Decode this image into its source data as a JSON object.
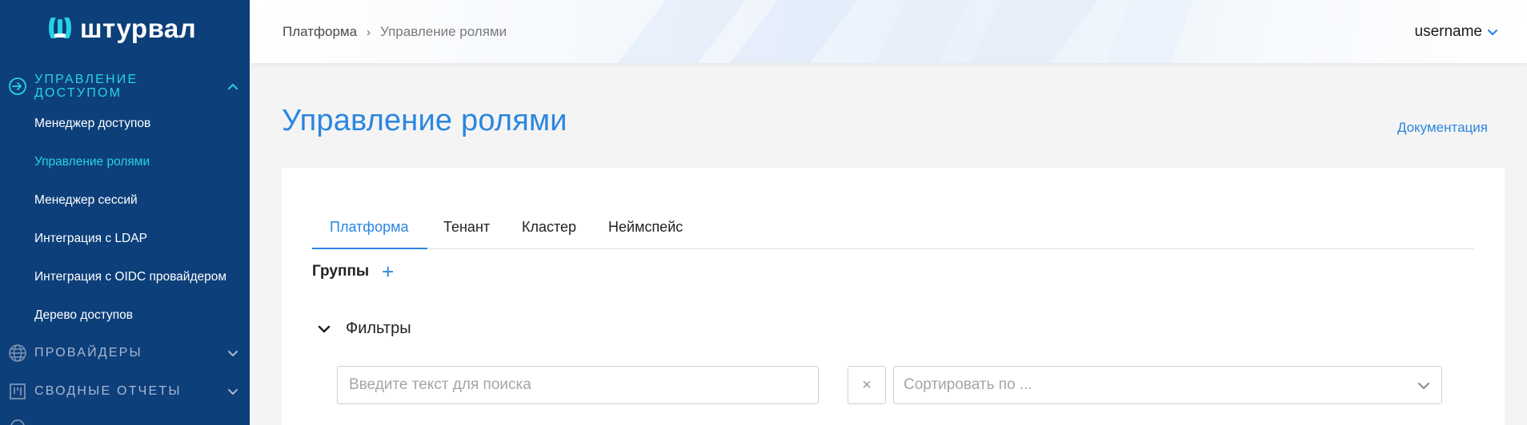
{
  "brand": {
    "name": "штурвал",
    "accent": "#27d3e3",
    "sidebar_bg": "#0d3f7a",
    "link": "#2b86e0"
  },
  "sidebar": {
    "sections": [
      {
        "label_line1": "Управление",
        "label_line2": "доступом",
        "icon": "sign-in-icon",
        "expanded": true
      },
      {
        "label": "Провайдеры",
        "icon": "globe-icon",
        "expanded": false
      },
      {
        "label": "Сводные отчеты",
        "icon": "board-icon",
        "expanded": false
      }
    ],
    "items": [
      {
        "label": "Менеджер доступов"
      },
      {
        "label": "Управление ролями",
        "active": true
      },
      {
        "label": "Менеджер сессий"
      },
      {
        "label": "Интеграция с LDAP"
      },
      {
        "label": "Интеграция с OIDC провайдером"
      },
      {
        "label": "Дерево доступов"
      }
    ]
  },
  "header": {
    "breadcrumb": [
      "Платформа",
      "Управление ролями"
    ],
    "user": "username"
  },
  "main": {
    "title": "Управление ролями",
    "doc_link": "Документация",
    "tabs": [
      {
        "label": "Платформа",
        "active": true
      },
      {
        "label": "Тенант"
      },
      {
        "label": "Кластер"
      },
      {
        "label": "Неймспейс"
      }
    ],
    "groups_label": "Группы",
    "add_symbol": "+",
    "filters_label": "Фильтры",
    "search_placeholder": "Введите текст для поиска",
    "clear_symbol": "×",
    "sort_placeholder": "Сортировать по ..."
  }
}
